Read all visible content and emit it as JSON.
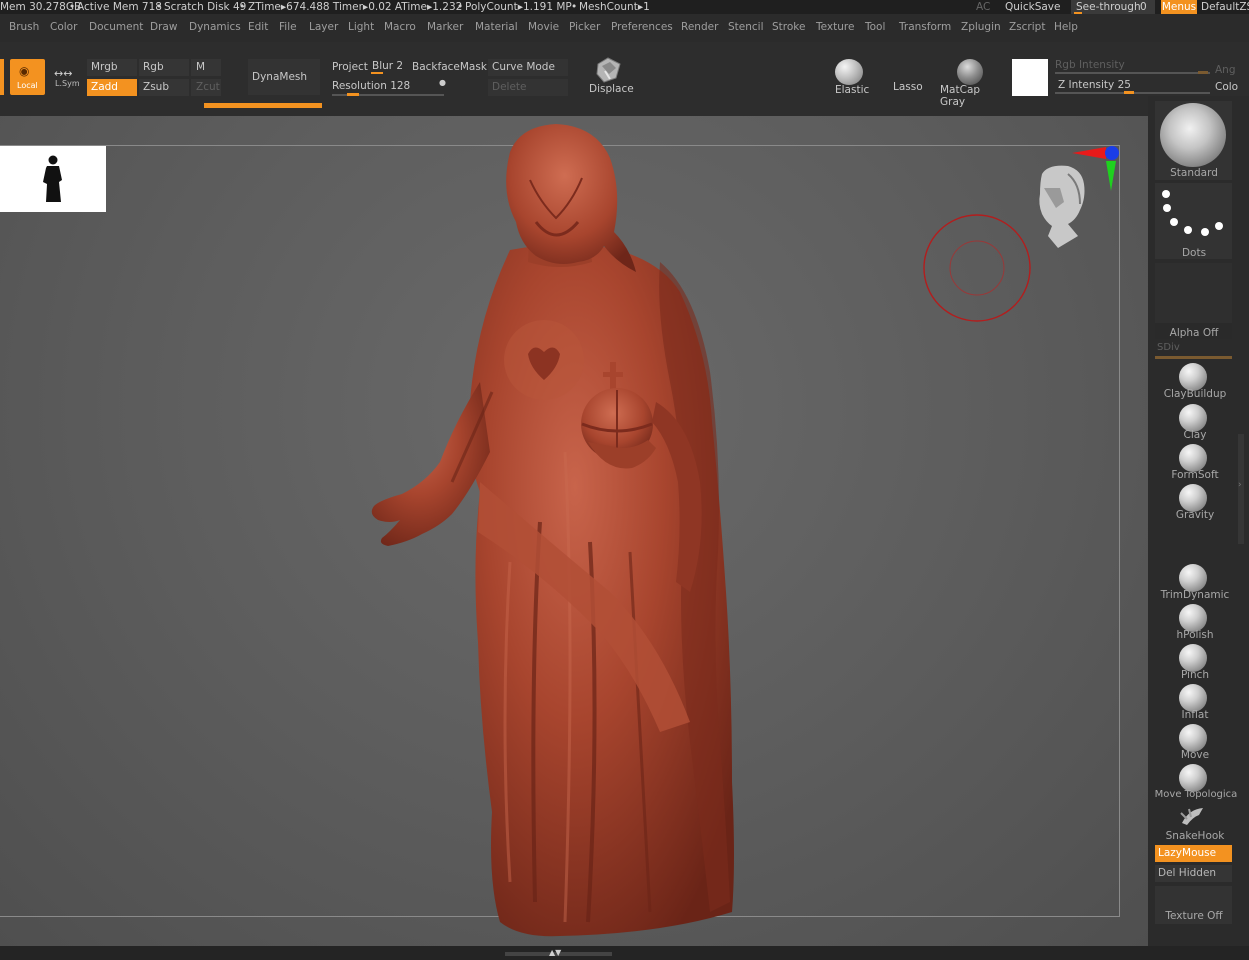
{
  "status": {
    "mem": "Mem 30.278GB",
    "active_mem": "Active Mem 718",
    "scratch": "Scratch Disk 49",
    "ztime": "ZTime▸674.488 Timer▸0.02 ATime▸1.232",
    "polycount": "PolyCount▸1.191 MP",
    "meshcount": "MeshCount▸1",
    "ac": "AC",
    "quicksave": "QuickSave",
    "see_through": "See-through",
    "see_through_value": "0",
    "menus": "Menus",
    "default_script": "DefaultZS"
  },
  "menus": [
    "Brush",
    "Color",
    "Document",
    "Draw",
    "Dynamics",
    "Edit",
    "File",
    "Layer",
    "Light",
    "Macro",
    "Marker",
    "Material",
    "Movie",
    "Picker",
    "Preferences",
    "Render",
    "Stencil",
    "Stroke",
    "Texture",
    "Tool",
    "Transform",
    "Zplugin",
    "Zscript",
    "Help"
  ],
  "toolbar": {
    "local": "Local",
    "lsym": "L.Sym",
    "mrgb": "Mrgb",
    "rgb": "Rgb",
    "m": "M",
    "zadd": "Zadd",
    "zsub": "Zsub",
    "zcut": "Zcut",
    "dynamesh": "DynaMesh",
    "project": "Project",
    "blur": "Blur 2",
    "backfacemask": "BackfaceMask",
    "resolution": "Resolution 128",
    "curve_mode": "Curve Mode",
    "delete": "Delete",
    "displace": "Displace",
    "elastic": "Elastic",
    "lasso": "Lasso",
    "matcap": "MatCap Gray",
    "rgb_intensity": "Rgb Intensity",
    "z_intensity": "Z Intensity 25",
    "ang": "Ang",
    "colo": "Colo"
  },
  "shelf": {
    "standard": "Standard",
    "dots": "Dots",
    "alpha_off": "Alpha Off",
    "sdiv": "SDiv",
    "brushes": [
      "ClayBuildup",
      "Clay",
      "FormSoft",
      "Gravity"
    ],
    "brushes2": [
      "TrimDynamic",
      "hPolish",
      "Pinch",
      "Inflat",
      "Move",
      "Move Topologica",
      "SnakeHook"
    ],
    "lazymouse": "LazyMouse",
    "del_hidden": "Del Hidden",
    "texture_off": "Texture Off"
  },
  "colors": {
    "accent": "#f39220",
    "model": "#a8452e"
  },
  "icons": {
    "model": "statue-model",
    "gyro": "head-gyro-icon",
    "axis": "axis-gizmo-icon",
    "cursor": "brush-cursor-icon"
  }
}
